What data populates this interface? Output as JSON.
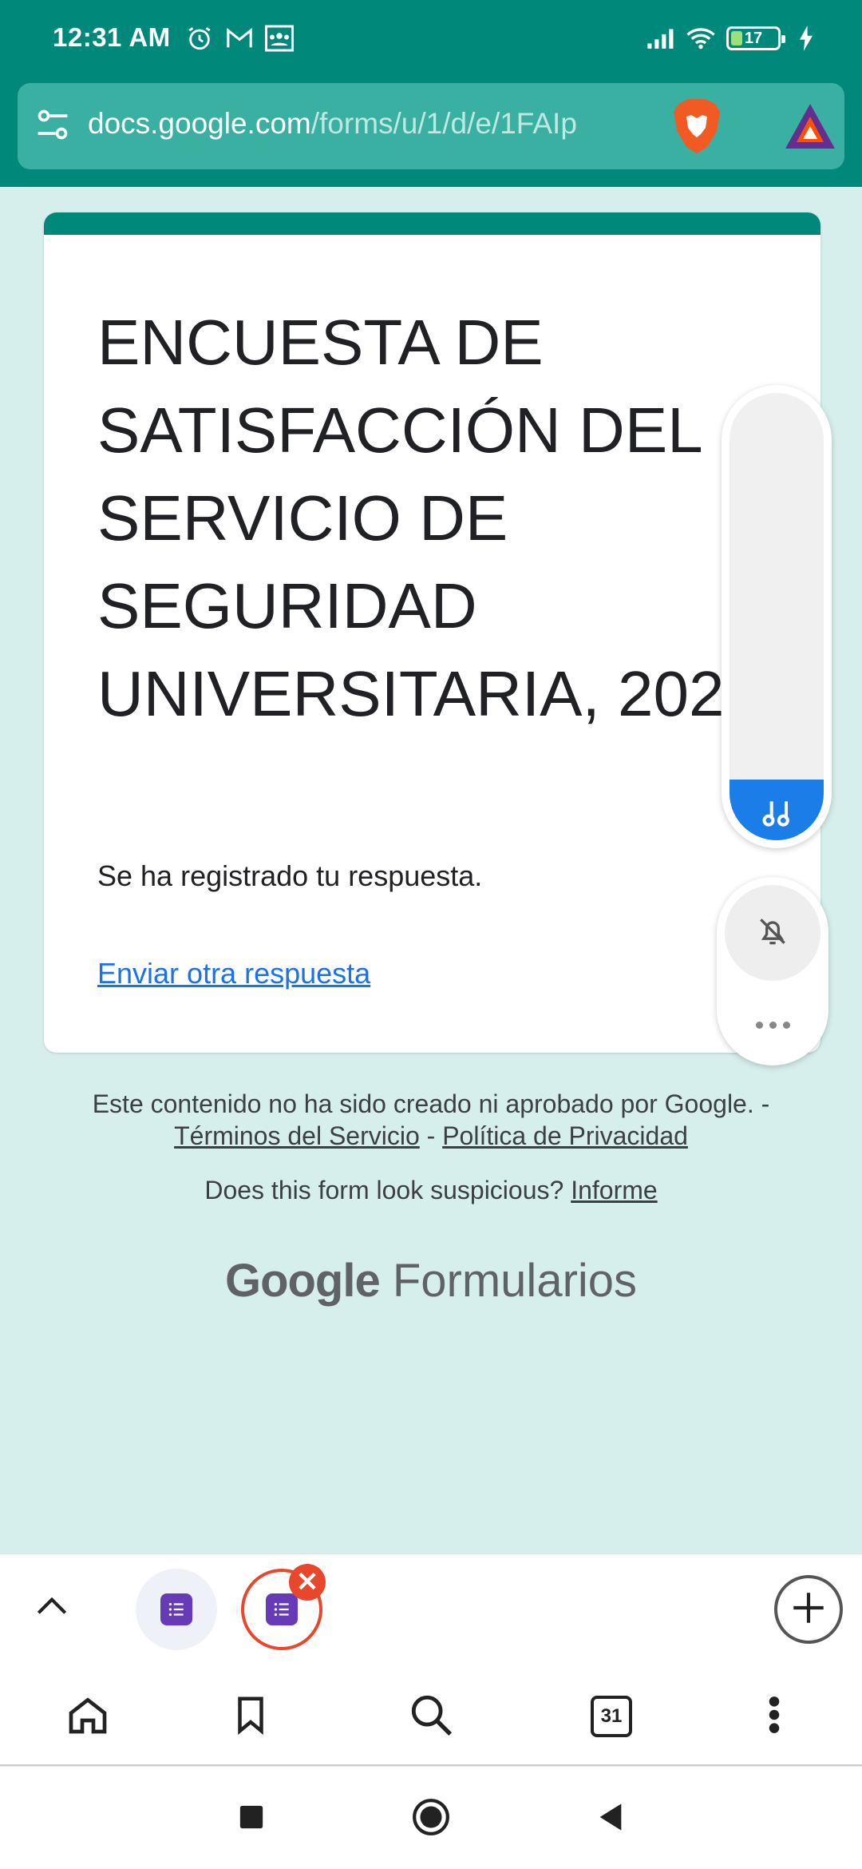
{
  "status_bar": {
    "time": "12:31 AM",
    "icons_left": [
      "alarm-icon",
      "gmail-icon",
      "classroom-icon"
    ],
    "icons_right": [
      "signal-icon",
      "wifi-icon",
      "battery-icon",
      "charging-icon"
    ],
    "battery_level": "17"
  },
  "url_bar": {
    "domain": "docs.google.com",
    "path": "/forms/u/1/d/e/1FAIp"
  },
  "form": {
    "title": "ENCUESTA DE SATISFACCIÓN DEL SERVICIO DE SEGURIDAD UNIVERSITARIA, 2024",
    "message": "Se ha registrado tu respuesta.",
    "link": "Enviar otra respuesta",
    "accent_color": "#00897b"
  },
  "footer": {
    "disclaimer": "Este contenido no ha sido creado ni aprobado por Google. -",
    "terms": "Términos del Servicio",
    "separator": " - ",
    "privacy": "Política de Privacidad",
    "report_question": "Does this form look suspicious?",
    "report_link": "Informe",
    "brand_google": "Google",
    "brand_product": "Formularios"
  },
  "tab_strip": {
    "tabs": [
      "forms-tab-icon",
      "forms-tab-icon"
    ],
    "close_glyph": "✕"
  },
  "toolbar": {
    "tab_count": "31"
  }
}
